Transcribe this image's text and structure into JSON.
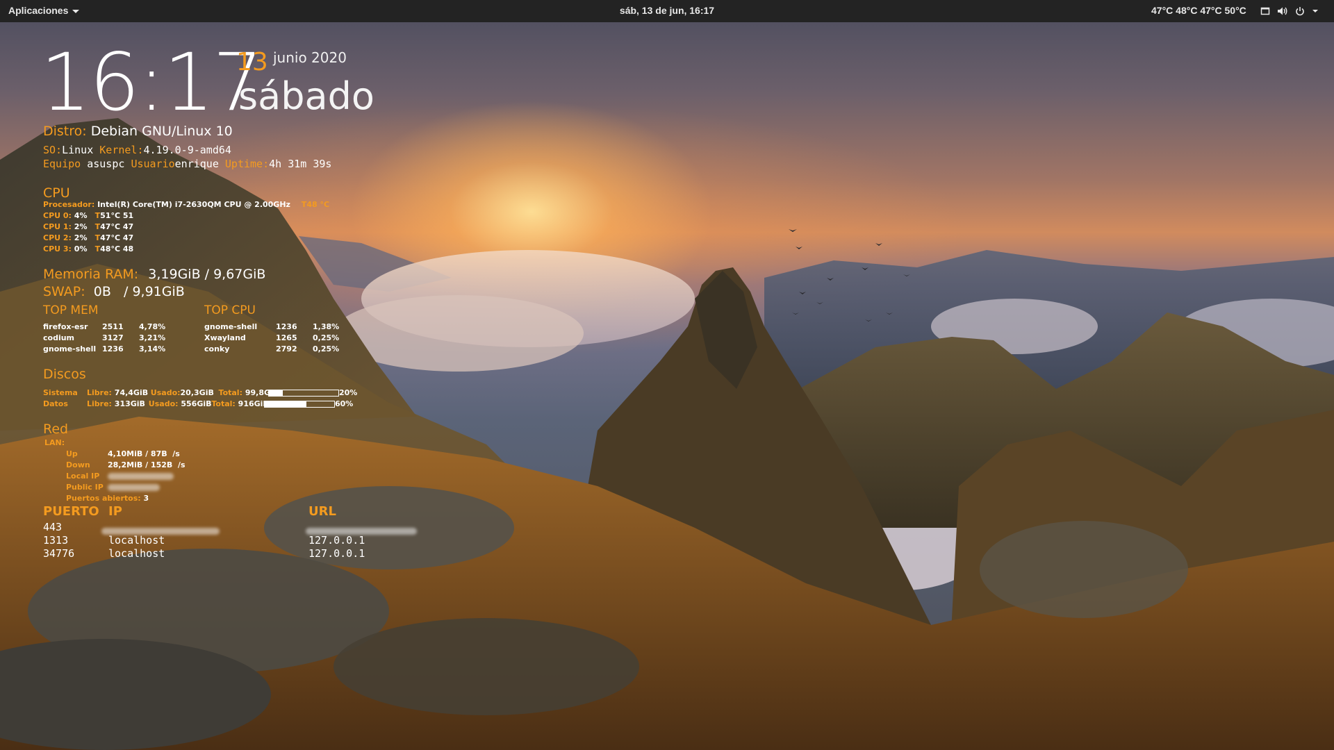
{
  "topbar": {
    "apps_label": "Aplicaciones",
    "clock": "sáb, 13 de jun, 16:17",
    "temps": "47°C 48°C 47°C 50°C",
    "tray_icons": [
      "window-icon",
      "volume-icon",
      "power-icon",
      "chevron-down-icon"
    ]
  },
  "clock": {
    "time": "16:17",
    "day": "13",
    "month_year": "junio 2020",
    "weekday": "sábado"
  },
  "system": {
    "distro_label": "Distro:",
    "distro": "Debian GNU/Linux 10",
    "os_label": "SO:",
    "os": "Linux",
    "kernel_label": "Kernel:",
    "kernel": "4.19.0-9-amd64",
    "host_label": "Equipo",
    "host": "asuspc",
    "user_label": "Usuario",
    "user": "enrique",
    "uptime_label": "Uptime:",
    "uptime": "4h 31m 39s"
  },
  "cpu": {
    "title": "CPU",
    "proc_label": "Procesador:",
    "proc": "Intel(R) Core(TM) i7-2630QM CPU @ 2.00GHz",
    "proc_temp_label": "T",
    "proc_temp": "48 °C",
    "cores": [
      {
        "label": "CPU 0:",
        "usage": "4%",
        "t_label": "T",
        "temp": "51°C 51"
      },
      {
        "label": "CPU 1:",
        "usage": "2%",
        "t_label": "T",
        "temp": "47°C 47"
      },
      {
        "label": "CPU 2:",
        "usage": "2%",
        "t_label": "T",
        "temp": "47°C 47"
      },
      {
        "label": "CPU 3:",
        "usage": "0%",
        "t_label": "T",
        "temp": "48°C 48"
      }
    ]
  },
  "memory": {
    "ram_label": "Memoria RAM:",
    "ram": "3,19GiB / 9,67GiB",
    "swap_label": "SWAP:",
    "swap": "0B   / 9,91GiB"
  },
  "top_mem": {
    "title": "TOP MEM",
    "rows": [
      {
        "name": "firefox-esr",
        "pid": "2511",
        "pct": "4,78%"
      },
      {
        "name": "codium",
        "pid": "3127",
        "pct": "3,21%"
      },
      {
        "name": "gnome-shell",
        "pid": "1236",
        "pct": "3,14%"
      }
    ]
  },
  "top_cpu": {
    "title": "TOP CPU",
    "rows": [
      {
        "name": "gnome-shell",
        "pid": "1236",
        "pct": "1,38%"
      },
      {
        "name": "Xwayland",
        "pid": "1265",
        "pct": "0,25%"
      },
      {
        "name": "conky",
        "pid": "2792",
        "pct": "0,25%"
      }
    ]
  },
  "disks": {
    "title": "Discos",
    "items": [
      {
        "name": "Sistema",
        "free_label": "Libre:",
        "free": "74,4GiB",
        "used_label": "Usado:",
        "used": "20,3GiB",
        "total_label": "Total:",
        "total": "99,8GiB",
        "pct": "20%",
        "fraction": 0.2
      },
      {
        "name": "Datos",
        "free_label": "Libre:",
        "free": "313GiB",
        "used_label": "Usado:",
        "used": "556GiB",
        "total_label": "Total:",
        "total": "916GiB",
        "pct": "60%",
        "fraction": 0.6
      }
    ]
  },
  "network": {
    "title": "Red",
    "lan_label": "LAN:",
    "up_label": "Up",
    "up": "4,10MiB / 87B  /s",
    "down_label": "Down",
    "down": "28,2MiB / 152B  /s",
    "local_ip_label": "Local IP",
    "public_ip_label": "Public IP",
    "ports_label": "Puertos abiertos:",
    "ports": "3"
  },
  "ports_table": {
    "headers": {
      "port": "PUERTO",
      "ip": "IP",
      "url": "URL"
    },
    "rows": [
      {
        "port": "443",
        "ip": "",
        "url": ""
      },
      {
        "port": "1313",
        "ip": "localhost",
        "url": "127.0.0.1"
      },
      {
        "port": "34776",
        "ip": "localhost",
        "url": "127.0.0.1"
      }
    ]
  },
  "colors": {
    "accent": "#f49b1f",
    "topbar_bg": "#232323",
    "text": "#ffffff"
  }
}
